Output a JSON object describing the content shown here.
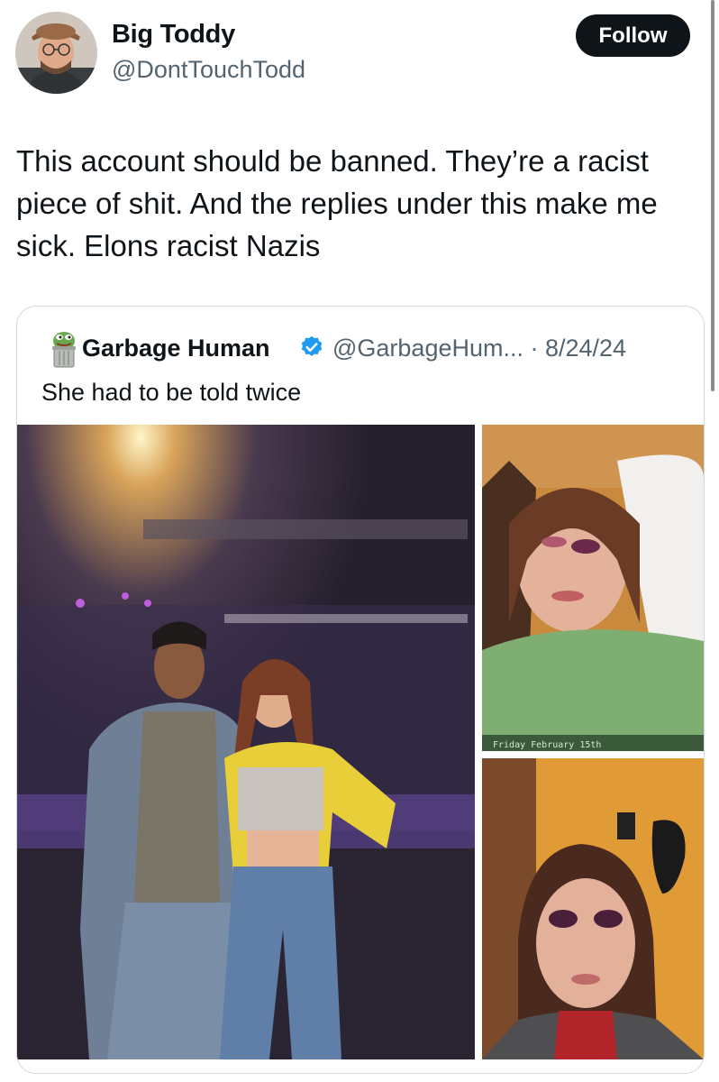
{
  "author": {
    "display_name": "Big Toddy",
    "handle": "@DontTouchTodd",
    "avatar_icon": "profile-photo-man-with-hat"
  },
  "follow_button": {
    "label": "Follow"
  },
  "tweet": {
    "text": "This account should be banned. They’re a racist piece of shit. And the replies under this make me sick. Elons racist Nazis"
  },
  "quote": {
    "display_name": "Garbage Human",
    "handle_date": "@GarbageHum... · 8/24/24",
    "text": "She had to be told twice",
    "verified_icon": "verified-badge-icon",
    "avatar_icon": "pepe-in-trash-can-icon",
    "photos": [
      {
        "name": "concert-couple-photo"
      },
      {
        "name": "hospital-bed-photo",
        "caption": "Friday February 15th"
      },
      {
        "name": "bruised-eyes-photo"
      }
    ]
  },
  "colors": {
    "text_primary": "#0f1419",
    "text_secondary": "#536471",
    "border": "#cfd9de",
    "verified_blue": "#1d9bf0",
    "button_bg": "#0f1419"
  }
}
